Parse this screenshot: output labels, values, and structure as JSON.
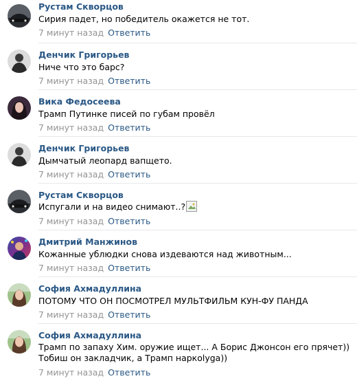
{
  "comments": [
    {
      "author": "Рустам Скворцов",
      "text": "Сирия падет, но победитель окажется не тот.",
      "time": "7 минут назад",
      "reply": "Ответить",
      "avatar": "car-avatar"
    },
    {
      "author": "Денчик Григорьев",
      "text": "Ниче что это барс?",
      "time": "7 минут назад",
      "reply": "Ответить",
      "avatar": "person-avatar"
    },
    {
      "author": "Вика Федосеева",
      "text": "Трамп Путинке писей по губам провёл",
      "time": "7 минут назад",
      "reply": "Ответить",
      "avatar": "girl-avatar"
    },
    {
      "author": "Денчик Григорьев",
      "text": "Дымчатый леопард вапщето.",
      "time": "7 минут назад",
      "reply": "Ответить",
      "avatar": "person-avatar"
    },
    {
      "author": "Рустам Скворцов",
      "text": "Испугали и на видео снимают..?",
      "time": "7 минут назад",
      "reply": "Ответить",
      "avatar": "car-avatar"
    },
    {
      "author": "Дмитрий Манжинов",
      "text": "Кожанные ублюдки снова издеваются над животным...",
      "time": "7 минут назад",
      "reply": "Ответить",
      "avatar": "colorful-avatar"
    },
    {
      "author": "София Ахмадуллина",
      "text": "ПОТОМУ ЧТО ОН ПОСМОТРЕЛ МУЛЬТФИЛЬМ КУН-ФУ ПАНДА",
      "time": "7 минут назад",
      "reply": "Ответить",
      "avatar": "girl-outdoor-avatar"
    },
    {
      "author": "София Ахмадуллина",
      "text": "Трамп по запаху Хим. оружие ищет... А Борис Джонсон его прячет)) Тобиш он закладчик, а Трамп наркоlyga))",
      "time": "7 минут назад",
      "reply": "Ответить",
      "avatar": "girl-outdoor-avatar"
    }
  ]
}
